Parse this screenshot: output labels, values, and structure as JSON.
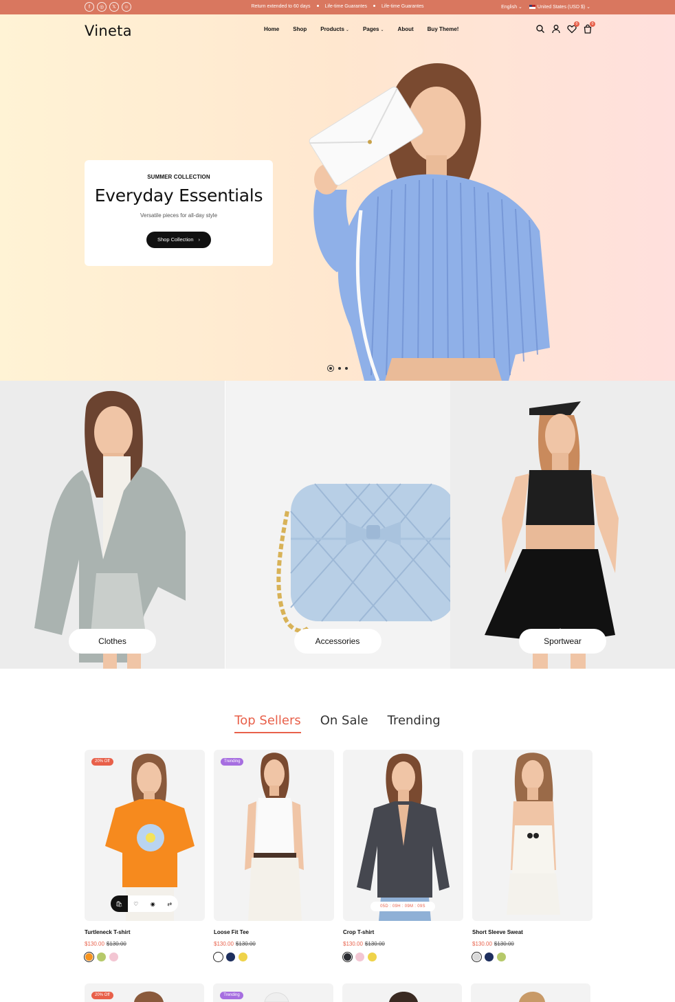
{
  "topbar": {
    "social": [
      "f",
      "◎",
      "𝕏",
      "☺"
    ],
    "notices": [
      "Return extended to 60 days",
      "Life-time Guarantes",
      "Life-time Guarantes"
    ],
    "language": "English",
    "currency": "United States (USD $)"
  },
  "nav": {
    "logo": "Vineta",
    "items": [
      {
        "label": "Home",
        "dropdown": false
      },
      {
        "label": "Shop",
        "dropdown": false
      },
      {
        "label": "Products",
        "dropdown": true
      },
      {
        "label": "Pages",
        "dropdown": true
      },
      {
        "label": "About",
        "dropdown": false
      },
      {
        "label": "Buy Theme!",
        "dropdown": false
      }
    ],
    "wishlist_count": "0",
    "cart_count": "0"
  },
  "hero": {
    "kicker": "SUMMER COLLECTION",
    "title": "Everyday Essentials",
    "subtitle": "Versatile pieces for all-day style",
    "button": "Shop Collection",
    "slides": 3,
    "active_slide": 1
  },
  "categories": [
    "Clothes",
    "Accessories",
    "Sportwear"
  ],
  "tabs": [
    {
      "label": "Top Sellers",
      "active": true
    },
    {
      "label": "On Sale",
      "active": false
    },
    {
      "label": "Trending",
      "active": false
    }
  ],
  "products": [
    {
      "name": "Turtleneck T-shirt",
      "price": "$130.00",
      "old_price": "$130.00",
      "tag": "20% Off",
      "tag_color": "#e8604a",
      "swatches": [
        "#f6931e",
        "#b6c96a",
        "#f3c6d3"
      ]
    },
    {
      "name": "Loose Fit Tee",
      "price": "$130.00",
      "old_price": "$130.00",
      "tag": "Trending",
      "tag_color": "#a66ee0",
      "swatches": [
        "#ffffff",
        "#1e2f5e",
        "#efd34a"
      ]
    },
    {
      "name": "Crop T-shirt",
      "price": "$130.00",
      "old_price": "$130.00",
      "tag": "",
      "tag_color": "",
      "swatches": [
        "#2b2d33",
        "#f3c6d3",
        "#efd34a"
      ],
      "countdown": "05D : 09H : 09M : 09S"
    },
    {
      "name": "Short Sleeve Sweat",
      "price": "$130.00",
      "old_price": "$130.00",
      "tag": "",
      "tag_color": "",
      "swatches": [
        "#d9d9d9",
        "#1e2f5e",
        "#b6c96a"
      ]
    }
  ],
  "row2_tags": [
    {
      "tag": "20% Off",
      "tag_color": "#e8604a"
    },
    {
      "tag": "Trending",
      "tag_color": "#a66ee0"
    },
    {
      "tag": "",
      "tag_color": ""
    },
    {
      "tag": "",
      "tag_color": ""
    }
  ]
}
